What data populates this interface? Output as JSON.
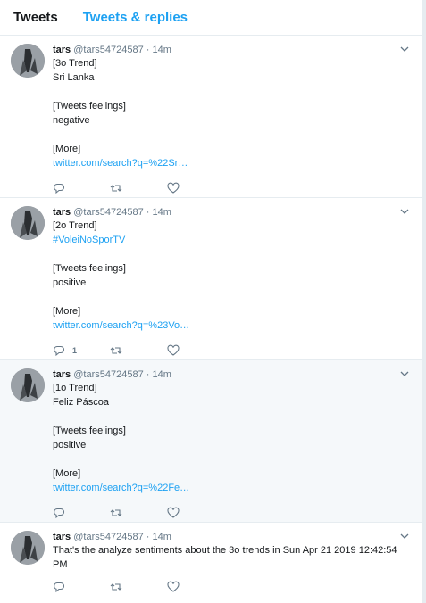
{
  "tabs": [
    {
      "label": "Tweets"
    },
    {
      "label": "Tweets & replies"
    }
  ],
  "tweets": [
    {
      "name": "tars",
      "handle": "@tars54724587",
      "dot": "·",
      "time": "14m",
      "lines": [
        "[3o Trend]",
        "Sri Lanka",
        "",
        "[Tweets feelings]",
        "negative",
        "",
        "[More]"
      ],
      "link": "twitter.com/search?q=%22Sr…",
      "reply_count": ""
    },
    {
      "name": "tars",
      "handle": "@tars54724587",
      "dot": "·",
      "time": "14m",
      "lines": [
        "[2o Trend]",
        "#VoleiNoSporTV",
        "",
        "[Tweets feelings]",
        "positive",
        "",
        "[More]"
      ],
      "link": "twitter.com/search?q=%23Vo…",
      "reply_count": "1"
    },
    {
      "name": "tars",
      "handle": "@tars54724587",
      "dot": "·",
      "time": "14m",
      "lines": [
        "[1o Trend]",
        "Feliz Páscoa",
        "",
        "[Tweets feelings]",
        "positive",
        "",
        "[More]"
      ],
      "link": "twitter.com/search?q=%22Fe…",
      "reply_count": ""
    },
    {
      "name": "tars",
      "handle": "@tars54724587",
      "dot": "·",
      "time": "14m",
      "lines": [
        "That's the analyze sentiments about the 3o trends in Sun Apr 21 2019 12:42:54 PM"
      ],
      "link": "",
      "reply_count": ""
    }
  ],
  "colors": {
    "accent": "#1da1f2",
    "muted": "#657786",
    "text": "#14171a",
    "hover_bg": "#f5f8fa"
  }
}
